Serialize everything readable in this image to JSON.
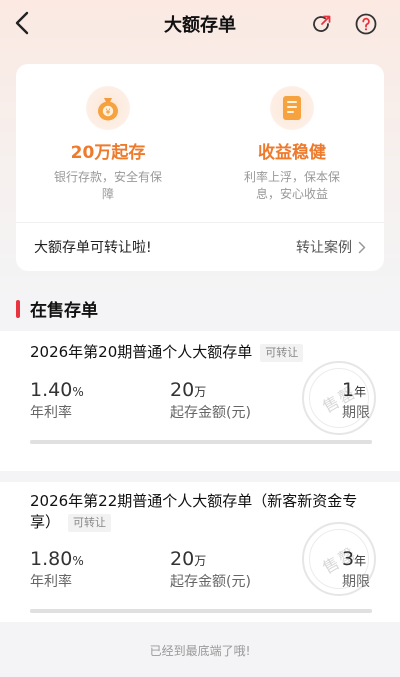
{
  "header": {
    "title": "大额存单"
  },
  "features": [
    {
      "title": "20万起存",
      "desc": "银行存款，安全有保障",
      "icon": "money-bag-icon"
    },
    {
      "title": "收益稳健",
      "desc": "利率上浮，保本保息，安心收益",
      "icon": "document-icon"
    }
  ],
  "transfer": {
    "text": "大额存单可转让啦!",
    "link": "转让案例"
  },
  "section": {
    "title": "在售存单"
  },
  "products": [
    {
      "name": "2026年第20期普通个人大额存单",
      "badge": "可转让",
      "rate": "1.40",
      "rate_unit": "%",
      "rate_label": "年利率",
      "amount": "20",
      "amount_unit": "万",
      "amount_label": "起存金额(元)",
      "term": "1",
      "term_unit": "年",
      "term_label": "期限",
      "stamp": "售罄",
      "progress": 1.0
    },
    {
      "name": "2026年第22期普通个人大额存单（新客新资金专享）",
      "badge": "可转让",
      "rate": "1.80",
      "rate_unit": "%",
      "rate_label": "年利率",
      "amount": "20",
      "amount_unit": "万",
      "amount_label": "起存金额(元)",
      "term": "3",
      "term_unit": "年",
      "term_label": "期限",
      "stamp": "售罄",
      "progress": 1.0
    }
  ],
  "footer": {
    "text": "已经到最底端了哦!"
  },
  "colors": {
    "accent": "#ee7a2c",
    "section_bar": "#e8343e"
  }
}
